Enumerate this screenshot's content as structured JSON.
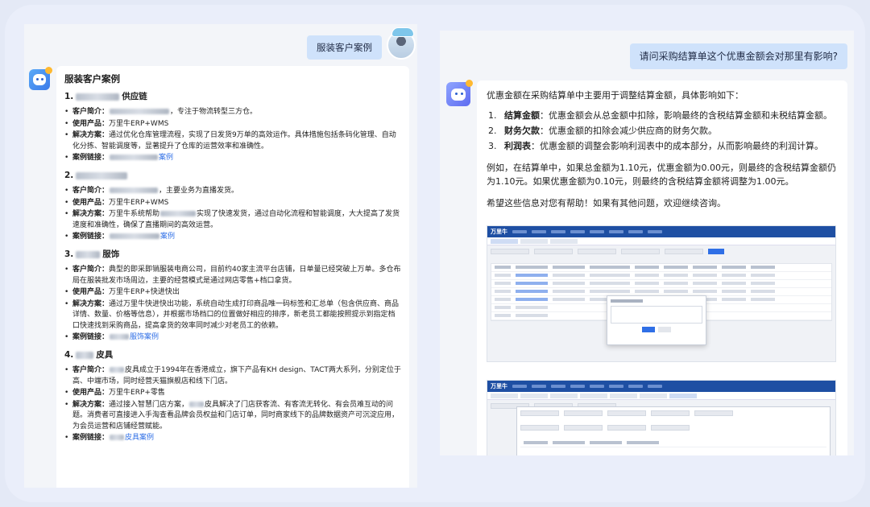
{
  "left": {
    "question": "服装客户案例",
    "title": "服装客户案例",
    "cases": [
      {
        "num": "1.",
        "name_suffix": "供应链",
        "items": [
          {
            "label": "客户简介：",
            "text": "，专注于物流转型三方仓。"
          },
          {
            "label": "使用产品：",
            "text": "万里牛ERP+WMS"
          },
          {
            "label": "解决方案：",
            "text": "通过优化仓库管理流程，实现了日发货9万单的高效运作。具体措施包括条码化管理、自动化分拣、智能调度等，显著提升了仓库的运营效率和准确性。"
          },
          {
            "label": "案例链接：",
            "link": "案例"
          }
        ]
      },
      {
        "num": "2.",
        "name_suffix": "",
        "items": [
          {
            "label": "客户简介：",
            "text": "，主要业务为直播发货。"
          },
          {
            "label": "使用产品：",
            "text": "万里牛ERP+WMS"
          },
          {
            "label": "解决方案：",
            "text_pre": "万里牛系统帮助",
            "text": "实现了快速发货，通过自动化流程和智能调度，大大提高了发货速度和准确性，确保了直播期间的高效运营。"
          },
          {
            "label": "案例链接：",
            "link": "案例"
          }
        ]
      },
      {
        "num": "3.",
        "name_suffix": "服饰",
        "items": [
          {
            "label": "客户简介：",
            "text": "典型的即采即销服装电商公司，目前约40家主流平台店铺，日单量已经突破上万单。多仓布局在服装批发市场周边，主要的经营模式是通过网店零售+档口拿货。"
          },
          {
            "label": "使用产品：",
            "text": "万里牛ERP+快进快出"
          },
          {
            "label": "解决方案：",
            "text": "通过万里牛快进快出功能，系统自动生成打印商品唯一码标签和汇总单（包含供应商、商品详情、数量、价格等信息），并根据市场档口的位置做好相应的排序，新老员工都能按照提示到指定档口快速找到采购商品，提高拿货的效率同时减少对老员工的依赖。"
          },
          {
            "label": "案例链接：",
            "link": "服饰案例"
          }
        ]
      },
      {
        "num": "4.",
        "name_suffix": "皮具",
        "items": [
          {
            "label": "客户简介：",
            "text": "皮具成立于1994年在香港成立，旗下产品有KH design、TACT两大系列，分别定位于高、中端市场，同时经营天猫旗舰店和线下门店。"
          },
          {
            "label": "使用产品：",
            "text": "万里牛ERP+零售"
          },
          {
            "label": "解决方案：",
            "text_pre": "通过接入智慧门店方案，",
            "text": "皮具解决了门店获客流、有客流无转化、有会员难互动的问题。消费者可直接进入手淘查看品牌会员权益和门店订单，同时商家线下的品牌数据资产可沉淀应用，为会员运营和店铺经营赋能。"
          },
          {
            "label": "案例链接：",
            "link": "皮具案例"
          }
        ]
      }
    ]
  },
  "right": {
    "question": "请问采购结算单这个优惠金额会对那里有影响?",
    "intro": "优惠金额在采购结算单中主要用于调整结算金额，具体影响如下：",
    "points": [
      {
        "num": "1.",
        "label": "结算金额",
        "text": "：优惠金额会从总金额中扣除，影响最终的含税结算金额和未税结算金额。"
      },
      {
        "num": "2.",
        "label": "财务欠款",
        "text": "：优惠金额的扣除会减少供应商的财务欠款。"
      },
      {
        "num": "3.",
        "label": "利润表",
        "text": "：优惠金额的调整会影响利润表中的成本部分，从而影响最终的利润计算。"
      }
    ],
    "example": "例如，在结算单中，如果总金额为1.10元，优惠金额为0.00元，则最终的含税结算金额仍为1.10元。如果优惠金额为0.10元，则最终的含税结算金额将调整为1.00元。",
    "closing": "希望这些信息对您有帮助！如果有其他问题，欢迎继续咨询。",
    "app_logo": "万里牛"
  }
}
